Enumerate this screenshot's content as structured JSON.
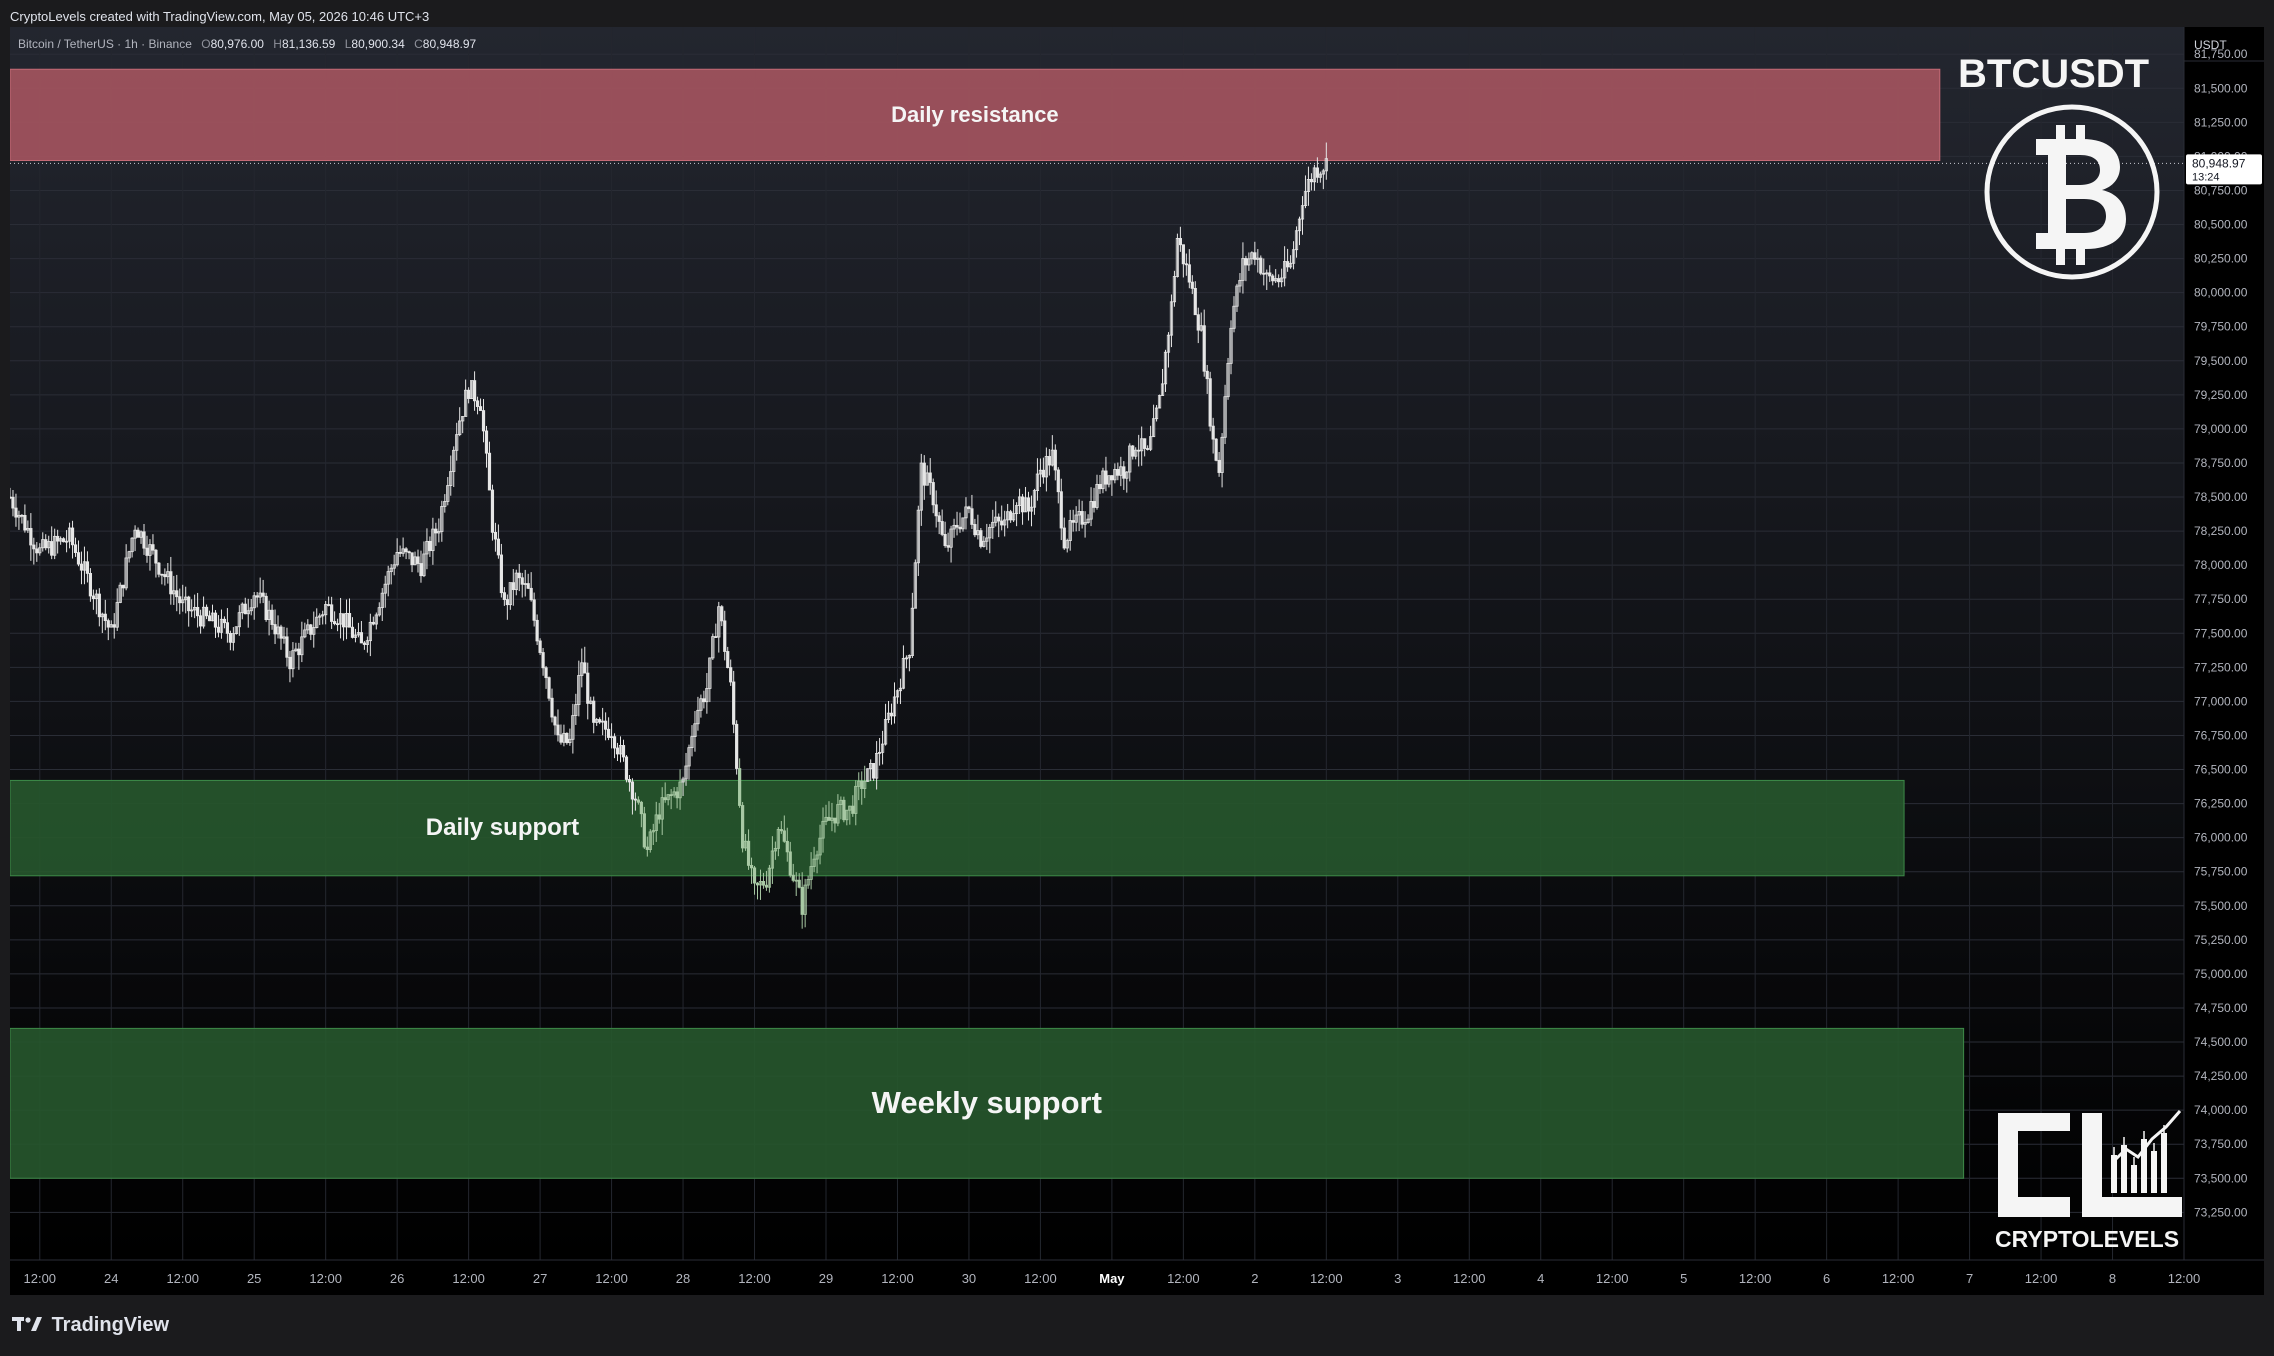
{
  "header": {
    "attribution": "CryptoLevels created with TradingView.com, May 05, 2026 10:46 UTC+3"
  },
  "legend": {
    "symbol": "Bitcoin / TetherUS · 1h · Binance",
    "o_label": "O",
    "o": "80,976.00",
    "h_label": "H",
    "h": "81,136.59",
    "l_label": "L",
    "l": "80,900.34",
    "c_label": "C",
    "c": "80,948.97"
  },
  "axis": {
    "currency": "USDT",
    "last_price": "80,948.97",
    "countdown": "13:24"
  },
  "brand": {
    "ticker": "BTCUSDT",
    "logo_text": "CRYPTOLEVELS",
    "footer_logo": "TradingView"
  },
  "colors": {
    "resistance": "#a3545e",
    "support": "#26562c",
    "candle": "#e6e6e6",
    "background": "#000000"
  },
  "chart_data": {
    "type": "candlestick",
    "timeframe": "1h",
    "ylim": [
      72900,
      81950
    ],
    "y_ticks": [
      81750,
      81500,
      81250,
      81000,
      80750,
      80500,
      80250,
      80000,
      79750,
      79500,
      79250,
      79000,
      78750,
      78500,
      78250,
      78000,
      77750,
      77500,
      77250,
      77000,
      76750,
      76500,
      76250,
      76000,
      75750,
      75500,
      75250,
      75000,
      74750,
      74500,
      74250,
      74000,
      73750,
      73500,
      73250
    ],
    "y_tick_labels": [
      "81,750.00",
      "81,500.00",
      "81,250.00",
      "81,000.00",
      "80,750.00",
      "80,500.00",
      "80,250.00",
      "80,000.00",
      "79,750.00",
      "79,500.00",
      "79,250.00",
      "79,000.00",
      "78,750.00",
      "78,500.00",
      "78,250.00",
      "78,000.00",
      "77,750.00",
      "77,500.00",
      "77,250.00",
      "77,000.00",
      "76,750.00",
      "76,500.00",
      "76,250.00",
      "76,000.00",
      "75,750.00",
      "75,500.00",
      "75,250.00",
      "75,000.00",
      "74,750.00",
      "74,500.00",
      "74,250.00",
      "74,000.00",
      "73,750.00",
      "73,500.00",
      "73,250.00"
    ],
    "x_tick_labels": [
      "12:00",
      "24",
      "12:00",
      "25",
      "12:00",
      "26",
      "12:00",
      "27",
      "12:00",
      "28",
      "12:00",
      "29",
      "12:00",
      "30",
      "12:00",
      "May",
      "12:00",
      "2",
      "12:00",
      "3",
      "12:00",
      "4",
      "12:00",
      "5",
      "12:00",
      "6",
      "12:00",
      "7",
      "12:00",
      "8",
      "12:00"
    ],
    "x_ticks_hours": [
      -40,
      -28,
      -16,
      -4,
      8,
      20,
      32,
      44,
      56,
      68,
      80,
      92,
      104,
      116,
      128,
      140,
      152,
      164,
      176,
      188,
      200,
      212,
      224,
      236,
      248,
      260,
      272,
      284,
      296,
      308,
      320
    ],
    "x_range_hours": [
      -45,
      320
    ],
    "zones": [
      {
        "label": "Daily resistance",
        "low": 80970,
        "high": 81640,
        "end_hour": 279,
        "color": "resistance"
      },
      {
        "label": "Daily support",
        "low": 75720,
        "high": 76420,
        "end_hour": 273,
        "color": "support"
      },
      {
        "label": "Weekly support",
        "low": 73500,
        "high": 74600,
        "end_hour": 283,
        "color": "support"
      }
    ],
    "price_path": [
      [
        -45,
        78500
      ],
      [
        -40,
        78100
      ],
      [
        -35,
        78200
      ],
      [
        -28,
        77500
      ],
      [
        -24,
        78300
      ],
      [
        -20,
        78000
      ],
      [
        -16,
        77700
      ],
      [
        -12,
        77600
      ],
      [
        -8,
        77500
      ],
      [
        -4,
        77800
      ],
      [
        -1,
        77600
      ],
      [
        2,
        77300
      ],
      [
        5,
        77500
      ],
      [
        8,
        77700
      ],
      [
        11,
        77600
      ],
      [
        14,
        77400
      ],
      [
        20,
        78100
      ],
      [
        24,
        78000
      ],
      [
        27,
        78300
      ],
      [
        30,
        79000
      ],
      [
        32,
        79300
      ],
      [
        34,
        79200
      ],
      [
        36,
        78300
      ],
      [
        38,
        77700
      ],
      [
        40,
        77900
      ],
      [
        42,
        77800
      ],
      [
        45,
        77200
      ],
      [
        47,
        76700
      ],
      [
        49,
        76700
      ],
      [
        51,
        77300
      ],
      [
        53,
        76800
      ],
      [
        56,
        76800
      ],
      [
        60,
        76300
      ],
      [
        62,
        75900
      ],
      [
        64,
        76200
      ],
      [
        66,
        76300
      ],
      [
        68,
        76400
      ],
      [
        70,
        76900
      ],
      [
        72,
        77100
      ],
      [
        74,
        77700
      ],
      [
        76,
        77100
      ],
      [
        78,
        76000
      ],
      [
        80,
        75600
      ],
      [
        82,
        75700
      ],
      [
        84,
        76100
      ],
      [
        86,
        75800
      ],
      [
        88,
        75500
      ],
      [
        90,
        75900
      ],
      [
        92,
        76100
      ],
      [
        94,
        76200
      ],
      [
        96,
        76200
      ],
      [
        98,
        76400
      ],
      [
        100,
        76500
      ],
      [
        102,
        76800
      ],
      [
        104,
        77100
      ],
      [
        106,
        77400
      ],
      [
        108,
        78700
      ],
      [
        110,
        78500
      ],
      [
        112,
        78100
      ],
      [
        114,
        78300
      ],
      [
        116,
        78400
      ],
      [
        118,
        78200
      ],
      [
        120,
        78300
      ],
      [
        122,
        78300
      ],
      [
        124,
        78500
      ],
      [
        126,
        78400
      ],
      [
        128,
        78700
      ],
      [
        130,
        78800
      ],
      [
        132,
        78200
      ],
      [
        134,
        78300
      ],
      [
        136,
        78400
      ],
      [
        138,
        78600
      ],
      [
        140,
        78700
      ],
      [
        142,
        78700
      ],
      [
        144,
        78900
      ],
      [
        146,
        78800
      ],
      [
        148,
        79200
      ],
      [
        150,
        79900
      ],
      [
        151,
        80400
      ],
      [
        153,
        80100
      ],
      [
        155,
        79700
      ],
      [
        157,
        78900
      ],
      [
        158,
        78700
      ],
      [
        160,
        79800
      ],
      [
        162,
        80200
      ],
      [
        164,
        80300
      ],
      [
        166,
        80100
      ],
      [
        168,
        80100
      ],
      [
        170,
        80200
      ],
      [
        172,
        80700
      ],
      [
        174,
        80900
      ],
      [
        176,
        80950
      ]
    ]
  }
}
